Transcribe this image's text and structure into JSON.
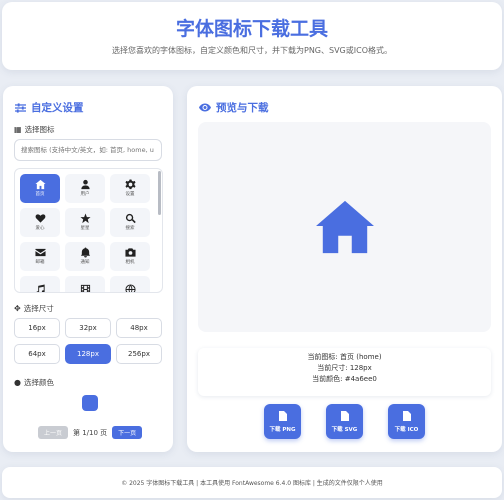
{
  "header": {
    "title": "字体图标下载工具",
    "subtitle": "选择您喜欢的字体图标，自定义颜色和尺寸，并下载为PNG、SVG或ICO格式。"
  },
  "settings": {
    "title": "自定义设置",
    "select_icon_label": "选择图标",
    "search_placeholder": "搜索图标 (支持中文/英文，如: 首页, home, u",
    "icons": [
      {
        "name": "house-icon",
        "label": "首页",
        "active": true
      },
      {
        "name": "user-icon",
        "label": "用户"
      },
      {
        "name": "gear-icon",
        "label": "设置"
      },
      {
        "name": "heart-icon",
        "label": "爱心"
      },
      {
        "name": "star-icon",
        "label": "星星"
      },
      {
        "name": "search-icon",
        "label": "搜索"
      },
      {
        "name": "envelope-icon",
        "label": "邮箱"
      },
      {
        "name": "bell-icon",
        "label": "通知"
      },
      {
        "name": "camera-icon",
        "label": "相机"
      },
      {
        "name": "music-icon",
        "label": ""
      },
      {
        "name": "film-icon",
        "label": ""
      },
      {
        "name": "globe-icon",
        "label": ""
      }
    ],
    "select_size_label": "选择尺寸",
    "sizes": [
      "16px",
      "32px",
      "48px",
      "64px",
      "128px",
      "256px"
    ],
    "active_size": "128px",
    "select_color_label": "选择颜色",
    "color": "#4a6ee0",
    "pager": {
      "prev": "上一页",
      "page_text": "第 1/10 页",
      "next": "下一页"
    }
  },
  "preview": {
    "title": "预览与下载",
    "current_icon": "当前图标: 首页 (home)",
    "current_size": "当前尺寸: 128px",
    "current_color": "当前颜色: #4a6ee0",
    "downloads": [
      "下载 PNG",
      "下载 SVG",
      "下载 ICO"
    ]
  },
  "footer": {
    "text": "© 2025 字体图标下载工具 | 本工具使用 FontAwesome 6.4.0 图标库 | 生成的文件仅限个人使用"
  },
  "colors": {
    "accent": "#4a6ee0",
    "background": "#e9edf4"
  }
}
